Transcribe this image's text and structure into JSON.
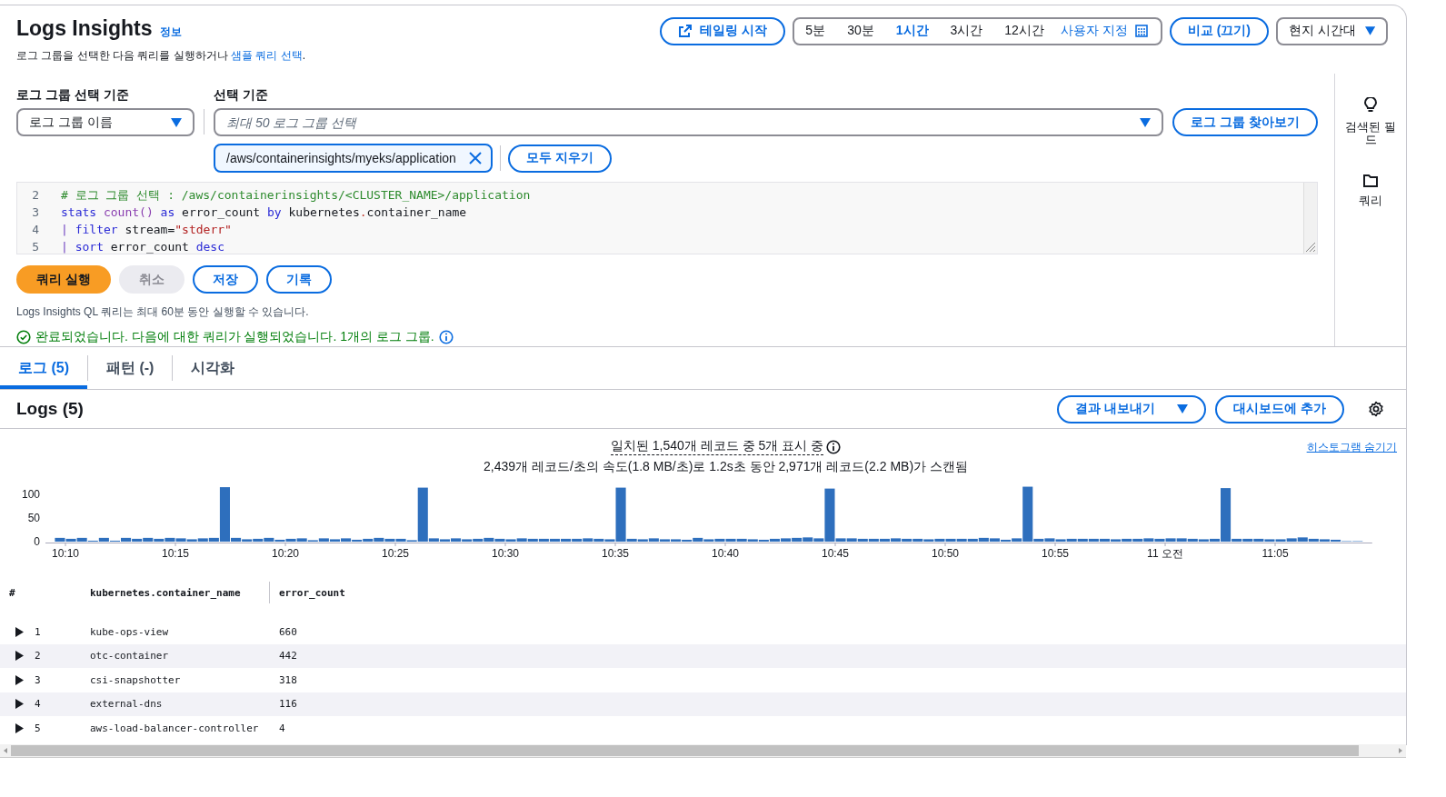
{
  "header": {
    "title": "Logs Insights",
    "info_link": "정보",
    "description": {
      "before": "로그 그룹을 선택한 다음 쿼리를 실행하거나 ",
      "link": "샘플 쿼리 선택",
      "after": "."
    }
  },
  "tail_button": "테일링 시작",
  "time_ranges": [
    {
      "label": "5분",
      "selected": false
    },
    {
      "label": "30분",
      "selected": false
    },
    {
      "label": "1시간",
      "selected": true
    },
    {
      "label": "3시간",
      "selected": false
    },
    {
      "label": "12시간",
      "selected": false
    }
  ],
  "custom_range": "사용자 지정",
  "compare_button": "비교 (끄기)",
  "timezone_select": "현지 시간대",
  "selection": {
    "mode_label": "로그 그룹 선택 기준",
    "mode_value": "로그 그룹 이름",
    "criteria_label": "선택 기준",
    "criteria_placeholder": "최대 50 로그 그룹 선택",
    "browse_button": "로그 그룹 찾아보기",
    "tokens": [
      "/aws/containerinsights/myeks/application"
    ],
    "clear_button": "모두 지우기"
  },
  "editor": {
    "lines": [
      {
        "number": "2",
        "tokens": [
          {
            "kind": "comment",
            "text": "# 로그 그룹 선택 : /aws/containerinsights/<CLUSTER_NAME>/application"
          }
        ]
      },
      {
        "number": "3",
        "tokens": [
          {
            "kind": "keyword",
            "text": "stats "
          },
          {
            "kind": "function",
            "text": "count() "
          },
          {
            "kind": "keyword",
            "text": "as"
          },
          {
            "kind": "plain",
            "text": " error_count "
          },
          {
            "kind": "keyword",
            "text": "by"
          },
          {
            "kind": "plain",
            "text": " kubernetes"
          },
          {
            "kind": "operator",
            "text": "."
          },
          {
            "kind": "plain",
            "text": "container_name"
          }
        ]
      },
      {
        "number": "4",
        "tokens": [
          {
            "kind": "pipe",
            "text": "| "
          },
          {
            "kind": "keyword",
            "text": "filter"
          },
          {
            "kind": "plain",
            "text": " stream="
          },
          {
            "kind": "string",
            "text": "\"stderr\""
          }
        ]
      },
      {
        "number": "5",
        "tokens": [
          {
            "kind": "pipe",
            "text": "| "
          },
          {
            "kind": "keyword",
            "text": "sort"
          },
          {
            "kind": "plain",
            "text": " error_count "
          },
          {
            "kind": "keyword",
            "text": "desc"
          }
        ]
      }
    ]
  },
  "actions": [
    {
      "kind": "primary",
      "label": "쿼리 실행",
      "disabled": false
    },
    {
      "kind": "normal",
      "label": "취소",
      "disabled": true
    },
    {
      "kind": "normal",
      "label": "저장",
      "disabled": false
    },
    {
      "kind": "normal",
      "label": "기록",
      "disabled": false
    }
  ],
  "note": "Logs Insights QL 쿼리는 최대 60분 동안 실행할 수 있습니다.",
  "status": "완료되었습니다. 다음에 대한 쿼리가 실행되었습니다. 1개의 로그 그룹.",
  "side_panel": [
    {
      "kind": "fields",
      "label": "검색된 필드"
    },
    {
      "kind": "queries",
      "label": "쿼리"
    }
  ],
  "result_tabs": [
    {
      "label": "로그 (5)",
      "selected": true
    },
    {
      "label": "패턴 (-)",
      "selected": false
    },
    {
      "label": "시각화",
      "selected": false
    }
  ],
  "logs": {
    "title": "Logs (5)",
    "export_button": "결과 내보내기",
    "dashboard_button": "대시보드에 추가"
  },
  "histogram": {
    "summary": "일치된 1,540개 레코드 중 5개 표시 중",
    "scan_info": "2,439개 레코드/초의 속도(1.8 MB/초)로 1.2s초 동안 2,971개 레코드(2.2 MB)가 스캔됨",
    "hide_link": "히스토그램 숨기기",
    "chart_data": {
      "type": "bar",
      "ylim": [
        0,
        120
      ],
      "yticks": [
        0,
        50,
        100
      ],
      "categories": [
        null,
        "10:10",
        null,
        null,
        null,
        null,
        null,
        null,
        null,
        null,
        null,
        "10:15",
        null,
        null,
        null,
        null,
        null,
        null,
        null,
        null,
        null,
        "10:20",
        null,
        null,
        null,
        null,
        null,
        null,
        null,
        null,
        null,
        "10:25",
        null,
        null,
        null,
        null,
        null,
        null,
        null,
        null,
        null,
        "10:30",
        null,
        null,
        null,
        null,
        null,
        null,
        null,
        null,
        null,
        "10:35",
        null,
        null,
        null,
        null,
        null,
        null,
        null,
        null,
        null,
        "10:40",
        null,
        null,
        null,
        null,
        null,
        null,
        null,
        null,
        null,
        "10:45",
        null,
        null,
        null,
        null,
        null,
        null,
        null,
        null,
        null,
        "10:50",
        null,
        null,
        null,
        null,
        null,
        null,
        null,
        null,
        null,
        "10:55",
        null,
        null,
        null,
        null,
        null,
        null,
        null,
        null,
        null,
        "11 오전",
        null,
        null,
        null,
        null,
        null,
        null,
        null,
        null,
        null,
        "11:05",
        null,
        null,
        null,
        null,
        null,
        null,
        null
      ],
      "series": [
        {
          "color": "#2e6fbd",
          "values": [
            8,
            6,
            8,
            2,
            8,
            2,
            8,
            6,
            8,
            6,
            8,
            7,
            5,
            7,
            8,
            116,
            8,
            5,
            6,
            8,
            4,
            6,
            7,
            3,
            7,
            5,
            7,
            4,
            6,
            8,
            6,
            6,
            3,
            115,
            7,
            5,
            7,
            5,
            6,
            8,
            6,
            5,
            7,
            6,
            6,
            6,
            6,
            6,
            7,
            6,
            5,
            115,
            6,
            5,
            7,
            5,
            5,
            4,
            8,
            5,
            6,
            6,
            6,
            5,
            4,
            6,
            7,
            8,
            9,
            7,
            113,
            7,
            7,
            6,
            6,
            6,
            7,
            6,
            6,
            5,
            6,
            6,
            6,
            6,
            8,
            7,
            4,
            7,
            117,
            6,
            7,
            5,
            6,
            6,
            6,
            6,
            5,
            6,
            6,
            7,
            6,
            7,
            7,
            6,
            5,
            6,
            114,
            6,
            6,
            6,
            5,
            5,
            7,
            9,
            6,
            5,
            4,
            1,
            1
          ]
        }
      ]
    }
  },
  "table": {
    "columns": [
      "#",
      "kubernetes.container_name",
      "error_count"
    ],
    "rows": [
      {
        "number": "1",
        "name": "kube-ops-view",
        "count": "660",
        "expanded": false
      },
      {
        "number": "2",
        "name": "otc-container",
        "count": "442",
        "expanded": false
      },
      {
        "number": "3",
        "name": "csi-snapshotter",
        "count": "318",
        "expanded": false
      },
      {
        "number": "4",
        "name": "external-dns",
        "count": "116",
        "expanded": false
      },
      {
        "number": "5",
        "name": "aws-load-balancer-controller",
        "count": "4",
        "expanded": false
      }
    ]
  }
}
